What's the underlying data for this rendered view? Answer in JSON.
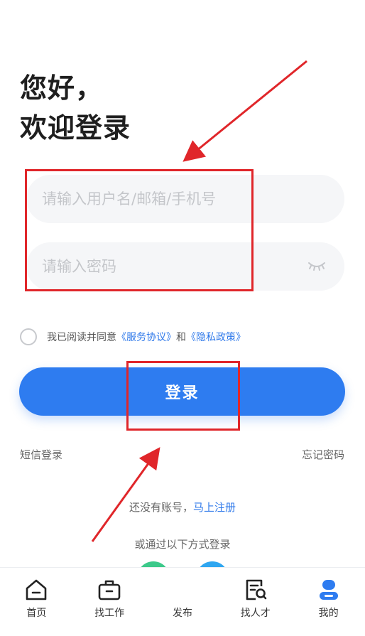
{
  "greeting": {
    "line1": "您好，",
    "line2": "欢迎登录"
  },
  "form": {
    "username_placeholder": "请输入用户名/邮箱/手机号",
    "password_placeholder": "请输入密码",
    "agree_prefix": "我已阅读并同意",
    "service_link": "《服务协议》",
    "and_text": "和",
    "privacy_link": "《隐私政策》",
    "login_label": "登录",
    "sms_login": "短信登录",
    "forgot_password": "忘记密码",
    "no_account": "还没有账号，",
    "register_link": "马上注册",
    "other_methods": "或通过以下方式登录"
  },
  "tabbar": {
    "items": [
      {
        "label": "首页",
        "icon": "home-icon"
      },
      {
        "label": "找工作",
        "icon": "briefcase-icon"
      },
      {
        "label": "发布",
        "icon": ""
      },
      {
        "label": "找人才",
        "icon": "search-document-icon"
      },
      {
        "label": "我的",
        "icon": "user-icon"
      }
    ],
    "active_index": 4
  },
  "colors": {
    "accent": "#2e7cf0",
    "link": "#2f79ea",
    "annotation": "#e0262a",
    "social_green": "#3cc98a",
    "social_blue": "#2fa6f0"
  }
}
